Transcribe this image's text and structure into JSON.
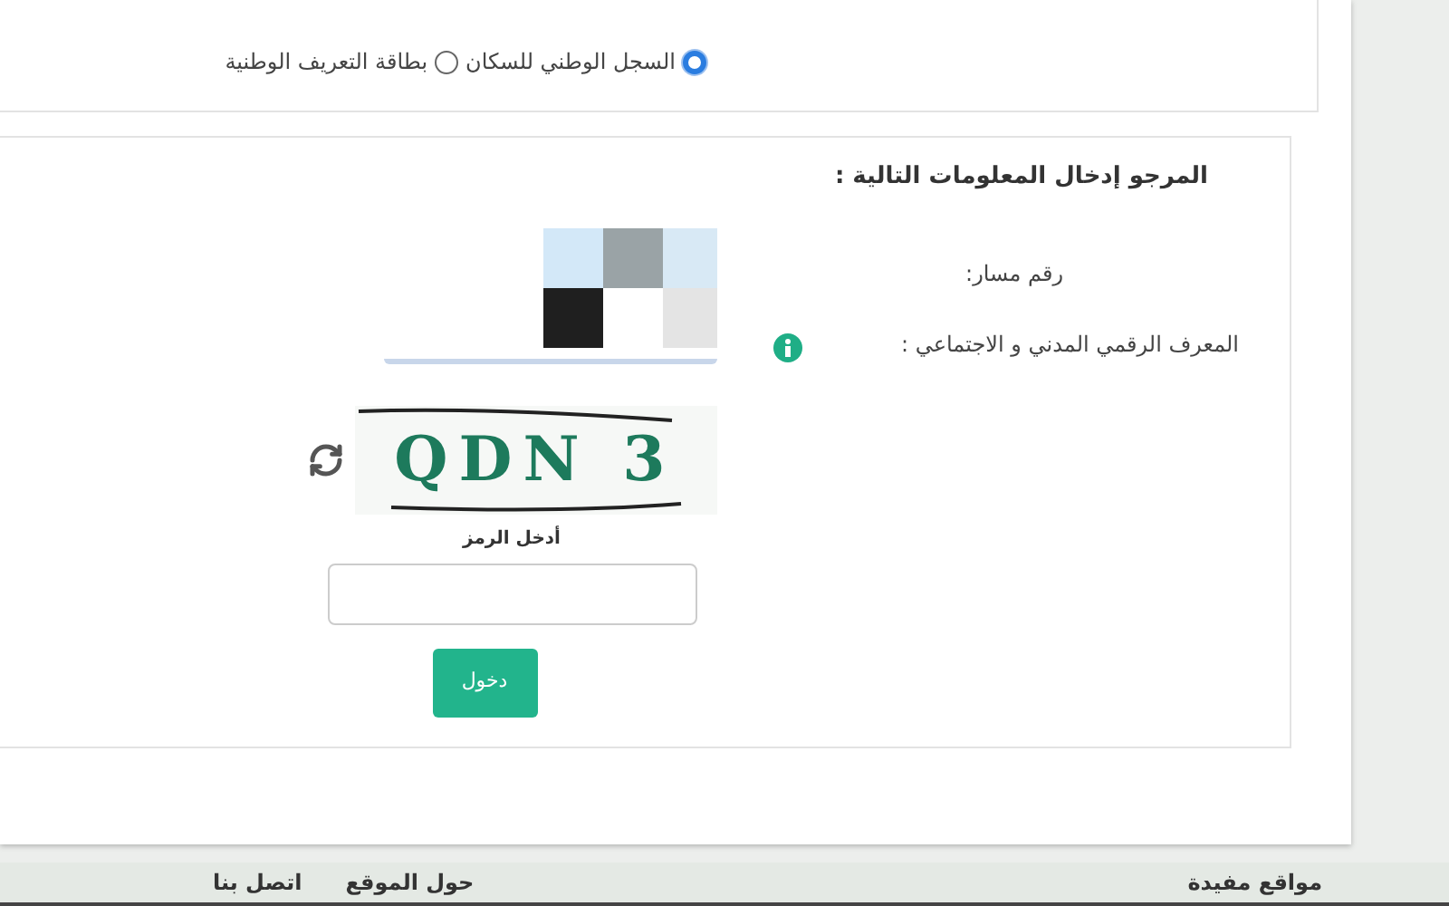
{
  "id_type_options": [
    {
      "label": "السجل الوطني للسكان",
      "selected": true
    },
    {
      "label": "بطاقة التعريف الوطنية",
      "selected": false
    }
  ],
  "form": {
    "heading": "المرجو إدخال المعلومات التالية :",
    "fields": [
      {
        "label": "رقم مسار:"
      },
      {
        "label": "المعرف الرقمي المدني و الاجتماعي :",
        "info": true
      }
    ],
    "captcha": {
      "text": "QDN 3",
      "code_label": "أدخل الرمز"
    },
    "submit": "دخول"
  },
  "footer": {
    "links": [
      "مواقع مفيدة",
      "حول الموقع",
      "اتصل بنا"
    ]
  }
}
